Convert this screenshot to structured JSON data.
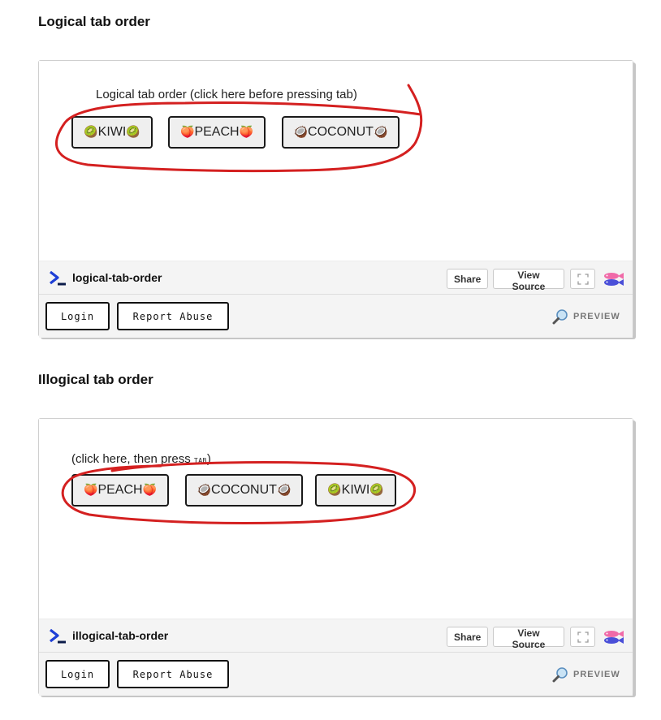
{
  "sections": [
    {
      "title": "Logical tab order",
      "caption": "Logical tab order (click here before pressing tab)",
      "buttons": [
        {
          "emoji": "🥝",
          "label": "KIWI"
        },
        {
          "emoji": "🍑",
          "label": "PEACH"
        },
        {
          "emoji": "🥥",
          "label": "COCONUT"
        }
      ],
      "pen_name": "logical-tab-order"
    },
    {
      "title": "Illogical tab order",
      "caption_prefix": "(click here, then press ",
      "caption_key": "TAB",
      "caption_suffix": ")",
      "buttons": [
        {
          "emoji": "🍑",
          "label": "PEACH"
        },
        {
          "emoji": "🥥",
          "label": "COCONUT"
        },
        {
          "emoji": "🥝",
          "label": "KIWI"
        }
      ],
      "pen_name": "illogical-tab-order"
    }
  ],
  "embed_ui": {
    "share_label": "Share",
    "view_source_label": "View Source",
    "login_label": "Login",
    "report_abuse_label": "Report Abuse",
    "preview_label": "PREVIEW",
    "icons": {
      "logo": "codepen-prompt-logo-icon",
      "fullscreen": "expand-icon",
      "fish": "fish-icon",
      "preview": "magnifier-icon"
    }
  },
  "colors": {
    "annotation_ink": "#d42020",
    "logo_blue": "#1e3fd6",
    "logo_dark": "#0b1b4a"
  }
}
